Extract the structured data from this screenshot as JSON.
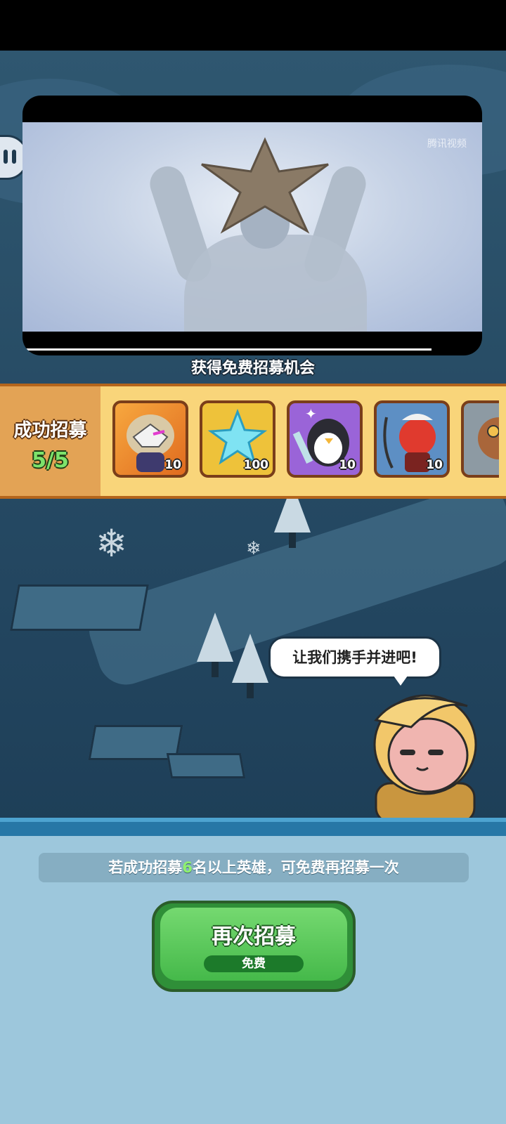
{
  "video": {
    "watermark": "腾讯视频",
    "progress_fraction": 0.89
  },
  "recruit_notice": "获得免费招募机会",
  "recruit_summary": {
    "title": "成功招募",
    "count": "5/5"
  },
  "rewards": [
    {
      "name": "masked-hero",
      "qty": "10"
    },
    {
      "name": "ice-crystal",
      "qty": "100"
    },
    {
      "name": "penguin-knight",
      "qty": "10"
    },
    {
      "name": "red-oni-warrior",
      "qty": "10"
    },
    {
      "name": "goggle-hero",
      "qty": ""
    }
  ],
  "npc": {
    "speech": "让我们携手并进吧!"
  },
  "info": {
    "prefix": "若成功招募",
    "number": "6",
    "suffix": "名以上英雄，可免费再招募一次"
  },
  "recruit_button": {
    "label": "再次招募",
    "cost": "免费"
  },
  "colors": {
    "strip": "#f9d57a",
    "button": "#45b94a",
    "count": "#7de36b"
  }
}
